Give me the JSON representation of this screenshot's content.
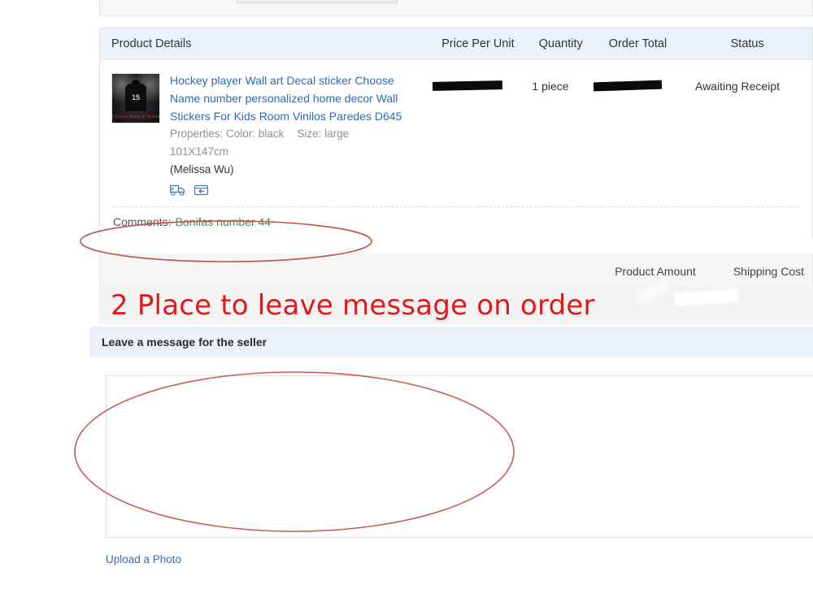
{
  "order_table": {
    "columns": [
      {
        "key": "product",
        "label": "Product Details"
      },
      {
        "key": "price",
        "label": "Price Per Unit"
      },
      {
        "key": "quantity",
        "label": "Quantity"
      },
      {
        "key": "total",
        "label": "Order Total"
      },
      {
        "key": "status",
        "label": "Status"
      }
    ],
    "item": {
      "title": "Hockey player Wall art Decal sticker Choose Name number personalized home decor Wall Stickers For Kids Room Vinilos Paredes D645",
      "properties_label": "Properties:",
      "property_color": "Color: black",
      "property_size": "Size: large 101X147cm",
      "seller": "(Melissa Wu)",
      "price_per_unit": "",
      "price_redacted": true,
      "quantity": "1 piece",
      "order_total": "",
      "total_redacted": true,
      "status": "Awaiting Receipt",
      "thumbnail": {
        "alt": "hockey-player-wall-decal-thumbnail",
        "jersey_number": "15",
        "caption": "Choose Name & Number"
      },
      "icons": [
        {
          "name": "shipping-truck-icon",
          "title": "Shipping"
        },
        {
          "name": "return-box-icon",
          "title": "Returns"
        }
      ]
    },
    "comments": {
      "label": "Comments:",
      "value": "Bonifas number 44",
      "value_color": "#3d9b35"
    }
  },
  "totals_band": {
    "product_amount_label": "Product Amount",
    "shipping_cost_label": "Shipping Cost"
  },
  "annotation": {
    "text": "2 Place to leave message on order",
    "color": "#e0191b"
  },
  "message_section": {
    "title": "Leave a message for the seller",
    "textarea_value": "",
    "textarea_placeholder": "",
    "upload_link_label": "Upload a Photo",
    "link_color": "#3a6bb0"
  },
  "highlights": [
    {
      "name": "comments-highlight-ellipse",
      "color": "#c0504d"
    },
    {
      "name": "message-box-highlight-ellipse",
      "color": "#cc5a55"
    }
  ]
}
